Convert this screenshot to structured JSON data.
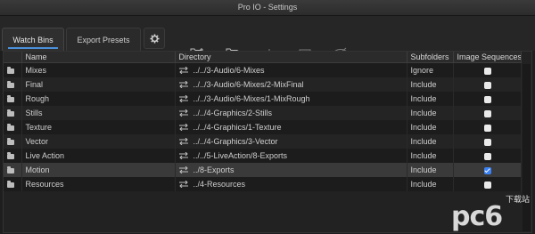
{
  "window": {
    "title": "Pro IO - Settings"
  },
  "tabs": [
    {
      "label": "Watch Bins",
      "active": true
    },
    {
      "label": "Export Presets",
      "active": false
    }
  ],
  "toolbar_icons": [
    "gear-icon",
    "add-folder-icon",
    "remove-folder-icon",
    "add-item-icon",
    "add-folder-disabled-icon",
    "visibility-toggle-icon"
  ],
  "table": {
    "columns": [
      "Name",
      "Directory",
      "Subfolders",
      "Image Sequences"
    ],
    "rows": [
      {
        "name": "Mixes",
        "directory": "../../3-Audio/6-Mixes",
        "subfolders": "Ignore",
        "image_sequences": false
      },
      {
        "name": "Final",
        "directory": "../../3-Audio/6-Mixes/2-MixFinal",
        "subfolders": "Include",
        "image_sequences": false
      },
      {
        "name": "Rough",
        "directory": "../../3-Audio/6-Mixes/1-MixRough",
        "subfolders": "Include",
        "image_sequences": false
      },
      {
        "name": "Stills",
        "directory": "../../4-Graphics/2-Stills",
        "subfolders": "Include",
        "image_sequences": false
      },
      {
        "name": "Texture",
        "directory": "../../4-Graphics/1-Texture",
        "subfolders": "Include",
        "image_sequences": false
      },
      {
        "name": "Vector",
        "directory": "../../4-Graphics/3-Vector",
        "subfolders": "Include",
        "image_sequences": false
      },
      {
        "name": "Live Action",
        "directory": "../../5-LiveAction/8-Exports",
        "subfolders": "Include",
        "image_sequences": false
      },
      {
        "name": "Motion",
        "directory": "../8-Exports",
        "subfolders": "Include",
        "image_sequences": true
      },
      {
        "name": "Resources",
        "directory": "../4-Resources",
        "subfolders": "Include",
        "image_sequences": false
      }
    ]
  },
  "watermark": {
    "logo": "pc6",
    "text": "下载站"
  },
  "colors": {
    "accent": "#3b82f6",
    "tab_underline": "#4a90d9"
  }
}
